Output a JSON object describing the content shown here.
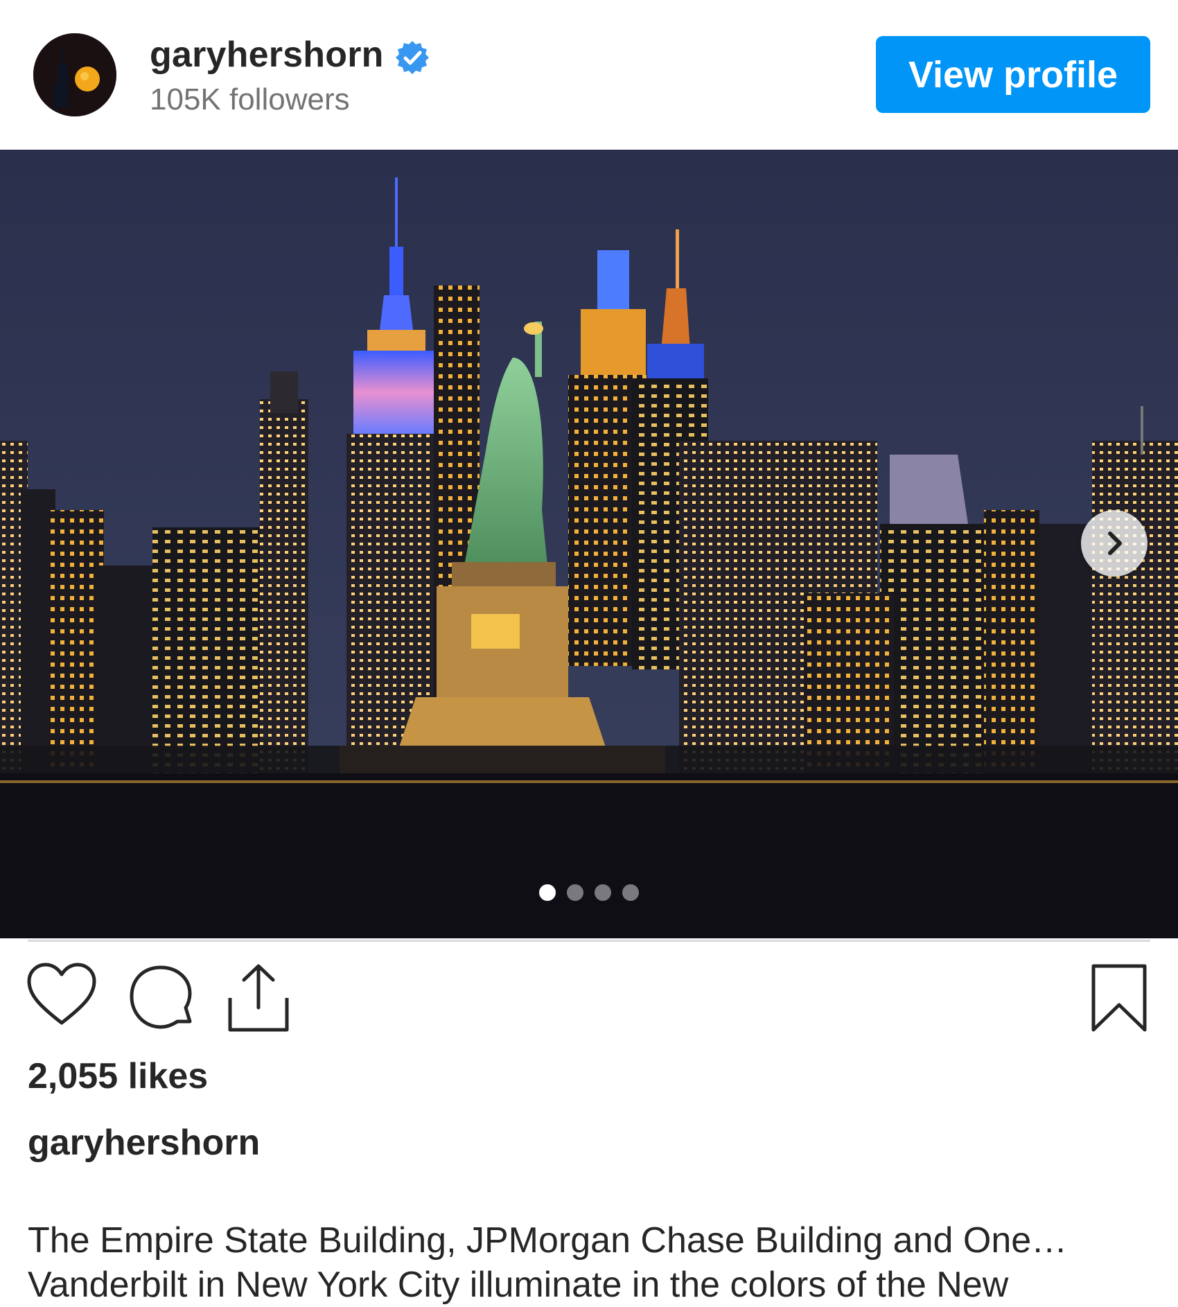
{
  "header": {
    "username": "garyhershorn",
    "followers": "105K followers",
    "view_profile_label": "View profile",
    "verified": true
  },
  "media": {
    "alt": "The Empire State Building, JPMorgan Chase Building and One Vanderbilt in New York City illuminate in the colors of the New",
    "carousel_total": 4,
    "carousel_active": 1
  },
  "actions": {
    "like_icon": "heart-icon",
    "comment_icon": "comment-icon",
    "share_icon": "share-icon",
    "save_icon": "bookmark-icon"
  },
  "post": {
    "likes": "2,055 likes",
    "caption_user": "garyhershorn",
    "caption_line1": "The Empire State Building, JPMorgan Chase Building and One…",
    "caption_line2": "Vanderbilt in New York City illuminate in the colors of the New"
  },
  "colors": {
    "accent": "#0095f6",
    "text": "#262626",
    "muted": "#737373",
    "divider": "#dbdbdb"
  }
}
